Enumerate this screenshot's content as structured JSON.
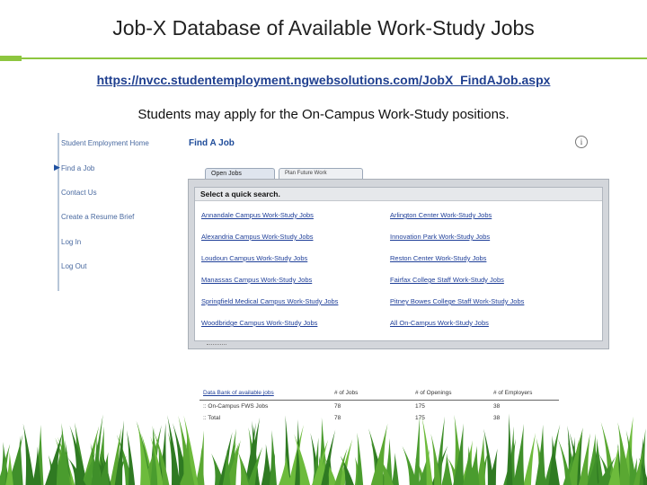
{
  "slide": {
    "title": "Job-X Database of Available Work-Study Jobs",
    "url": "https://nvcc.studentemployment.ngwebsolutions.com/JobX_FindAJob.aspx",
    "caption": "Students may apply for the On-Campus Work-Study positions.",
    "accent_color": "#8dc63f"
  },
  "sidebar": {
    "items": [
      {
        "label": "Student Employment Home"
      },
      {
        "label": "Find a Job"
      },
      {
        "label": "Contact Us"
      },
      {
        "label": "Create a Resume Brief"
      },
      {
        "label": "Log In"
      },
      {
        "label": "Log Out"
      }
    ],
    "active_marker": "▶"
  },
  "page": {
    "title": "Find A Job",
    "info_icon": "info-icon"
  },
  "tabs": [
    {
      "label": "Open Jobs"
    },
    {
      "label": "Plan Future Work Experiences"
    }
  ],
  "quick_search": {
    "header": "Select a quick search.",
    "left_links": [
      "Annandale Campus Work-Study Jobs",
      "Alexandria Campus Work-Study Jobs",
      "Loudoun Campus Work-Study Jobs",
      "Manassas Campus Work-Study Jobs",
      "Springfield Medical Campus Work-Study Jobs",
      "Woodbridge Campus Work-Study Jobs"
    ],
    "right_links": [
      "Arlington Center Work-Study Jobs",
      "Innovation Park Work-Study Jobs",
      "Reston Center Work-Study Jobs",
      "Fairfax College Staff Work-Study Jobs",
      "Pitney Bowes College Staff Work-Study Jobs",
      "All On-Campus Work-Study Jobs"
    ]
  },
  "data_bank": {
    "headers": [
      "Data Bank of available jobs",
      "# of Jobs",
      "# of Openings",
      "# of Employers"
    ],
    "rows": [
      [
        ":: On-Campus FWS Jobs",
        "78",
        "175",
        "38"
      ],
      [
        ":: Total",
        "78",
        "175",
        "38"
      ]
    ]
  }
}
